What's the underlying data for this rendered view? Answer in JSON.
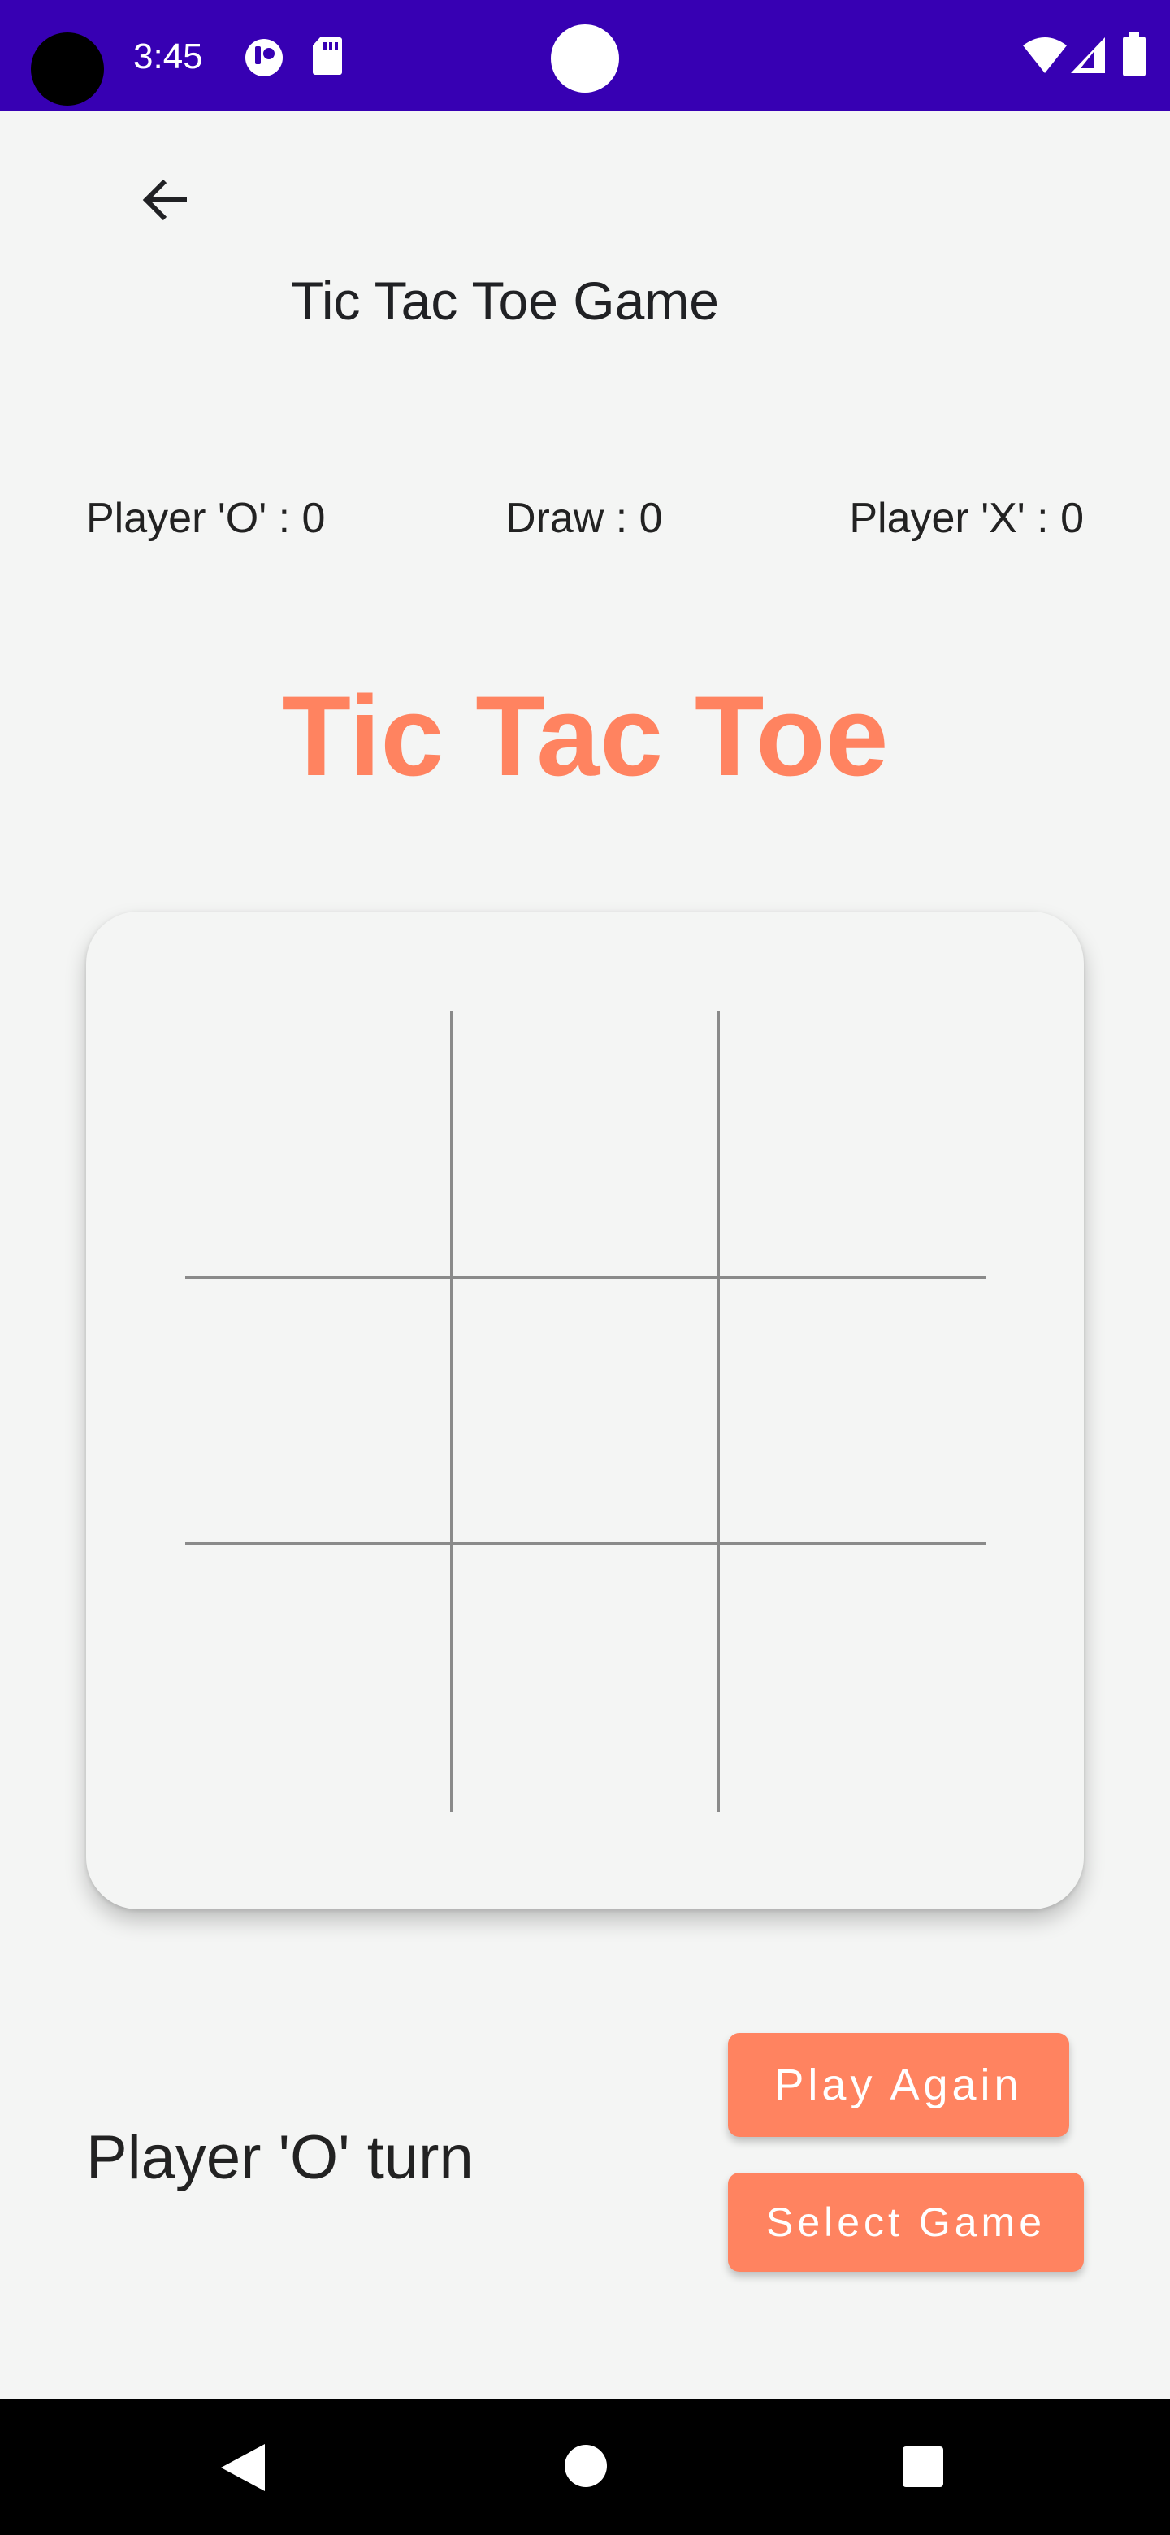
{
  "status_bar": {
    "time": "3:45",
    "background": "#3700b3",
    "icons": [
      "camera-hole",
      "game-controller-icon",
      "sd-card-icon",
      "notch-dot",
      "wifi-icon",
      "signal-icon",
      "battery-icon"
    ]
  },
  "toolbar": {
    "back_icon": "arrow-left-icon",
    "title": "Tic Tac Toe Game"
  },
  "scores": {
    "player_o": "Player 'O' : 0",
    "draw": "Draw : 0",
    "player_x": "Player 'X' : 0"
  },
  "game": {
    "title": "Tic Tac Toe",
    "accent_color": "#ff8360",
    "board": [
      "",
      "",
      "",
      "",
      "",
      "",
      "",
      "",
      ""
    ],
    "turn_text": "Player 'O' turn"
  },
  "actions": {
    "play_again": "Play Again",
    "select_game": "Select Game"
  },
  "nav_bar": {
    "icons": [
      "back-triangle-icon",
      "home-circle-icon",
      "recents-square-icon"
    ]
  }
}
